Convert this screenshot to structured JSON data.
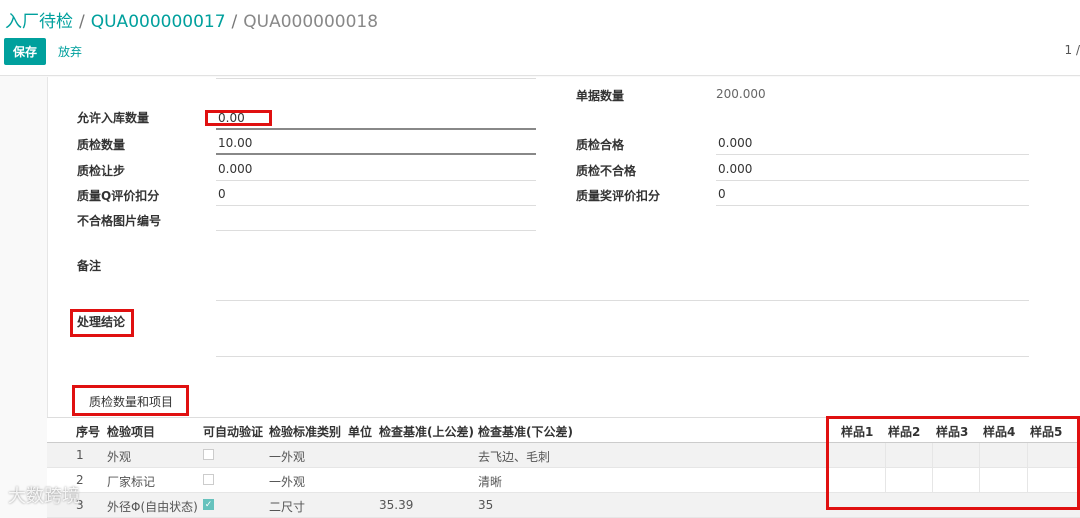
{
  "breadcrumb": {
    "root": "入厂待检",
    "middle": "QUA000000017",
    "current": "QUA000000018",
    "sep": "/"
  },
  "toolbar": {
    "save_label": "保存",
    "discard_label": "放弃",
    "pager": "1 /"
  },
  "form": {
    "doc_qty_label": "单据数量",
    "doc_qty_value": "200.000",
    "allow_in_label": "允许入库数量",
    "allow_in_value": "0.00",
    "qc_qty_label": "质检数量",
    "qc_qty_value": "10.00",
    "qc_pass_label": "质检合格",
    "qc_pass_value": "0.000",
    "qc_concession_label": "质检让步",
    "qc_concession_value": "0.000",
    "qc_fail_label": "质检不合格",
    "qc_fail_value": "0.000",
    "q_deduct_label": "质量Q评价扣分",
    "q_deduct_value": "0",
    "q_reward_label": "质量奖评价扣分",
    "q_reward_value": "0",
    "reject_img_label": "不合格图片编号",
    "note_label": "备注",
    "conclusion_label": "处理结论",
    "section_tab": "质检数量和项目"
  },
  "table": {
    "headers": [
      "序号",
      "检验项目",
      "可自动验证",
      "检验标准类别",
      "单位",
      "检查基准(上公差)",
      "检查基准(下公差)"
    ],
    "sample_headers": [
      "样品1",
      "样品2",
      "样品3",
      "样品4",
      "样品5"
    ],
    "rows": [
      {
        "no": "1",
        "item": "外观",
        "auto": false,
        "category": "一外观",
        "unit": "",
        "upper": "",
        "lower": "去飞边、毛刺"
      },
      {
        "no": "2",
        "item": "厂家标记",
        "auto": false,
        "category": "一外观",
        "unit": "",
        "upper": "",
        "lower": "清晰"
      },
      {
        "no": "3",
        "item": "外径Φ(自由状态)",
        "auto": true,
        "category": "二尺寸",
        "unit": "",
        "upper": "35.39",
        "lower": "35"
      }
    ]
  },
  "watermark": "大数跨境"
}
